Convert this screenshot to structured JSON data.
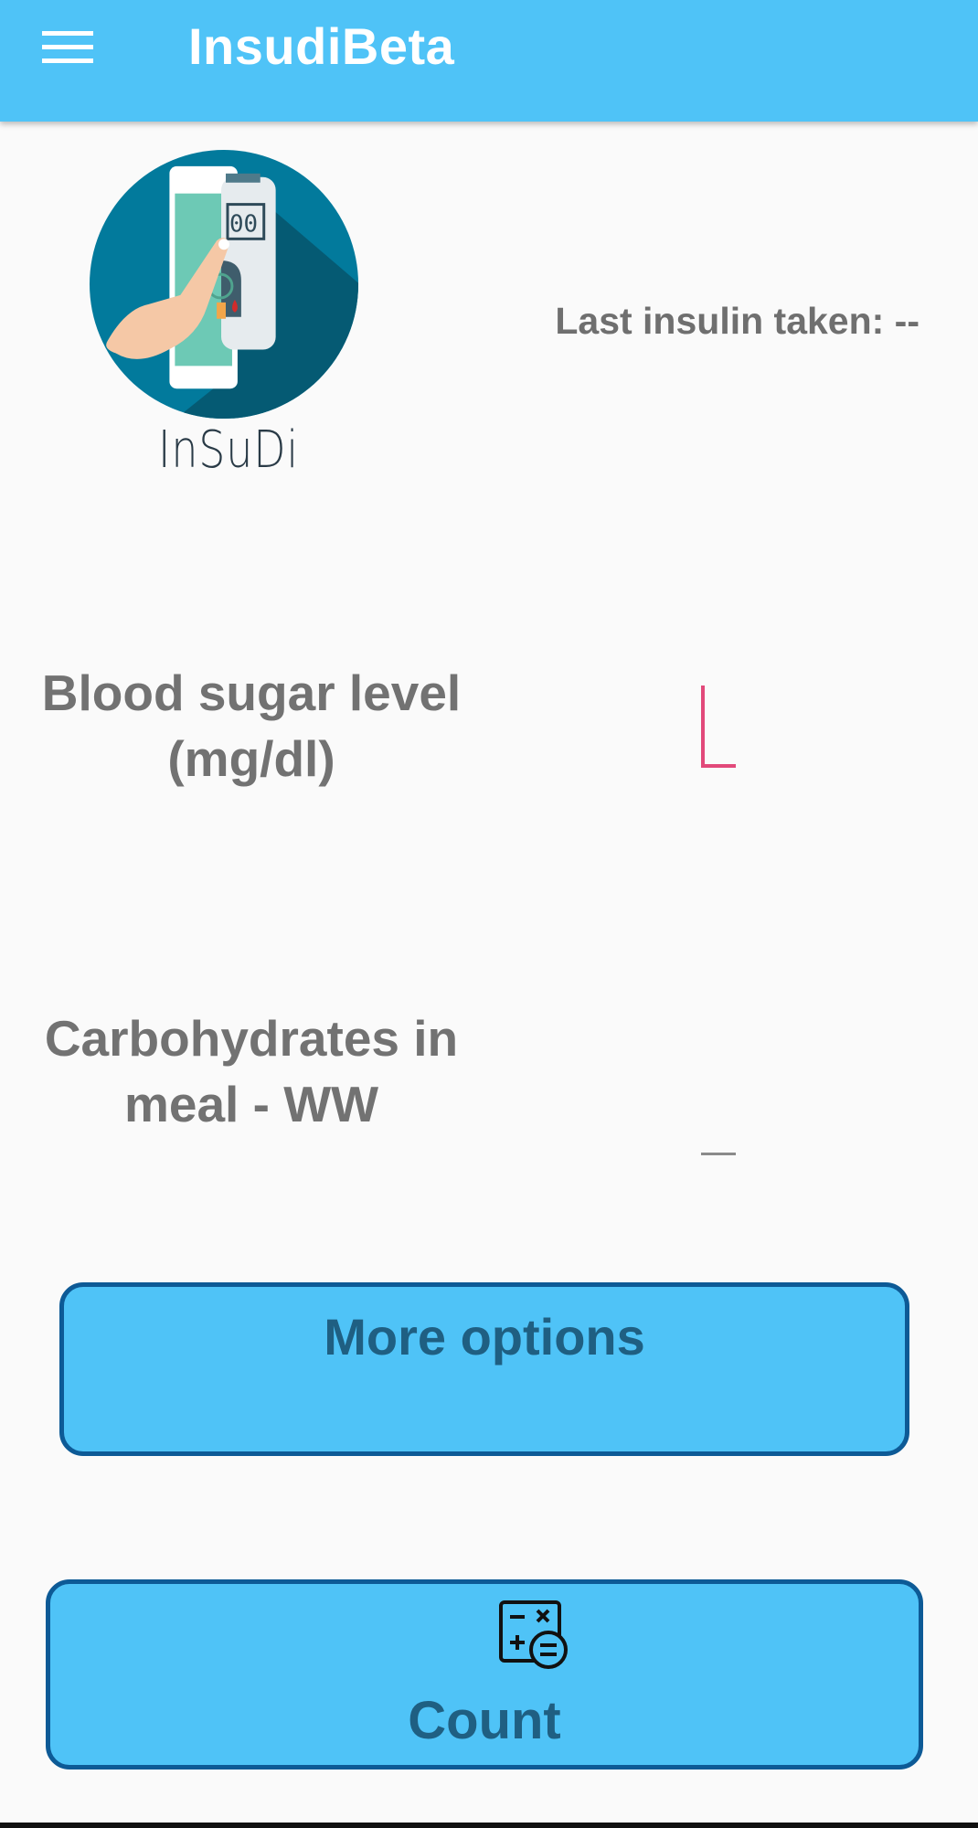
{
  "app_bar": {
    "menu_icon": "hamburger-menu-icon",
    "title": "InsudiBeta"
  },
  "logo": {
    "text": "InSuDi"
  },
  "last_insulin": {
    "text": "Last insulin taken: --"
  },
  "fields": {
    "blood_sugar": {
      "label_line1": "Blood sugar level",
      "label_line2": "(mg/dl)",
      "value": ""
    },
    "carbs": {
      "label_line1": "Carbohydrates in",
      "label_line2": "meal - WW",
      "value": ""
    }
  },
  "buttons": {
    "more_options": "More options",
    "count": "Count",
    "count_icon": "calculator-icon"
  },
  "colors": {
    "primary": "#4fc3f7",
    "button_border": "#0d5a96",
    "button_text": "#1f5f82",
    "accent": "#e2497a",
    "label_text": "#727272"
  }
}
